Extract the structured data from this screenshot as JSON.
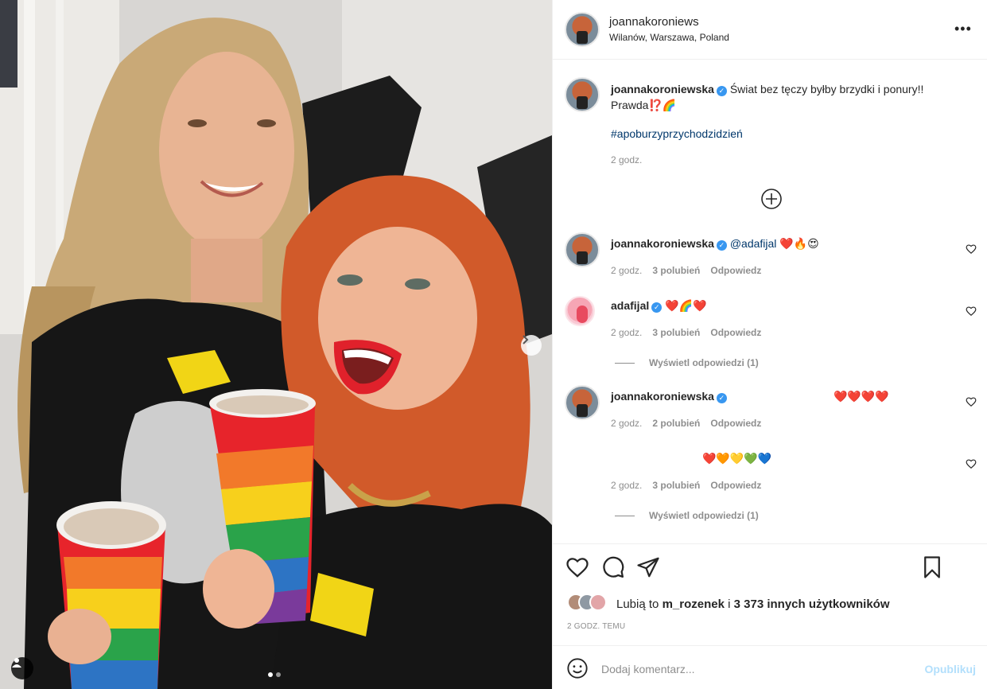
{
  "post": {
    "username": "joannakoroniews",
    "location": "Wilanów, Warszawa, Poland"
  },
  "caption": {
    "username": "joannakoroniewska",
    "text_line1": "Świat bez tęczy byłby brzydki i ponury!!",
    "text_line2": "Prawda⁉️🌈",
    "hashtag": "#apoburzyprzychodzidzień",
    "time": "2 godz."
  },
  "comments": [
    {
      "username": "joannakoroniewska",
      "mention": "@adafijal",
      "emoji": "❤️🔥😍",
      "time": "2 godz.",
      "likes": "3 polubień",
      "reply": "Odpowiedz"
    },
    {
      "username": "adafijal",
      "emoji": "❤️🌈❤️",
      "time": "2 godz.",
      "likes": "3 polubień",
      "reply": "Odpowiedz",
      "view_replies": "Wyświetl odpowiedzi (1)"
    },
    {
      "username": "joannakoroniewska",
      "emoji": "❤️❤️❤️❤️",
      "time": "2 godz.",
      "likes": "2 polubień",
      "reply": "Odpowiedz"
    },
    {
      "emoji": "❤️🧡💛💚💙",
      "time": "2 godz.",
      "likes": "3 polubień",
      "reply": "Odpowiedz",
      "view_replies": "Wyświetl odpowiedzi (1)"
    }
  ],
  "likes": {
    "prefix": "Lubią to",
    "user": "m_rozenek",
    "middle": "i",
    "others": "3 373 innych użytkowników"
  },
  "post_time": "2 GODZ. TEMU",
  "add_comment": {
    "placeholder": "Dodaj komentarz...",
    "publish": "Opublikuj"
  },
  "icons": {
    "more": "more-options-icon",
    "heart": "heart-icon",
    "comment": "comment-icon",
    "share": "share-icon",
    "save": "bookmark-icon",
    "emoji": "emoji-icon",
    "add": "plus-circle-icon"
  },
  "colors": {
    "link": "#00376b",
    "verified": "#3897f0",
    "muted": "#8e8e8e",
    "publish": "#b2dffc"
  }
}
